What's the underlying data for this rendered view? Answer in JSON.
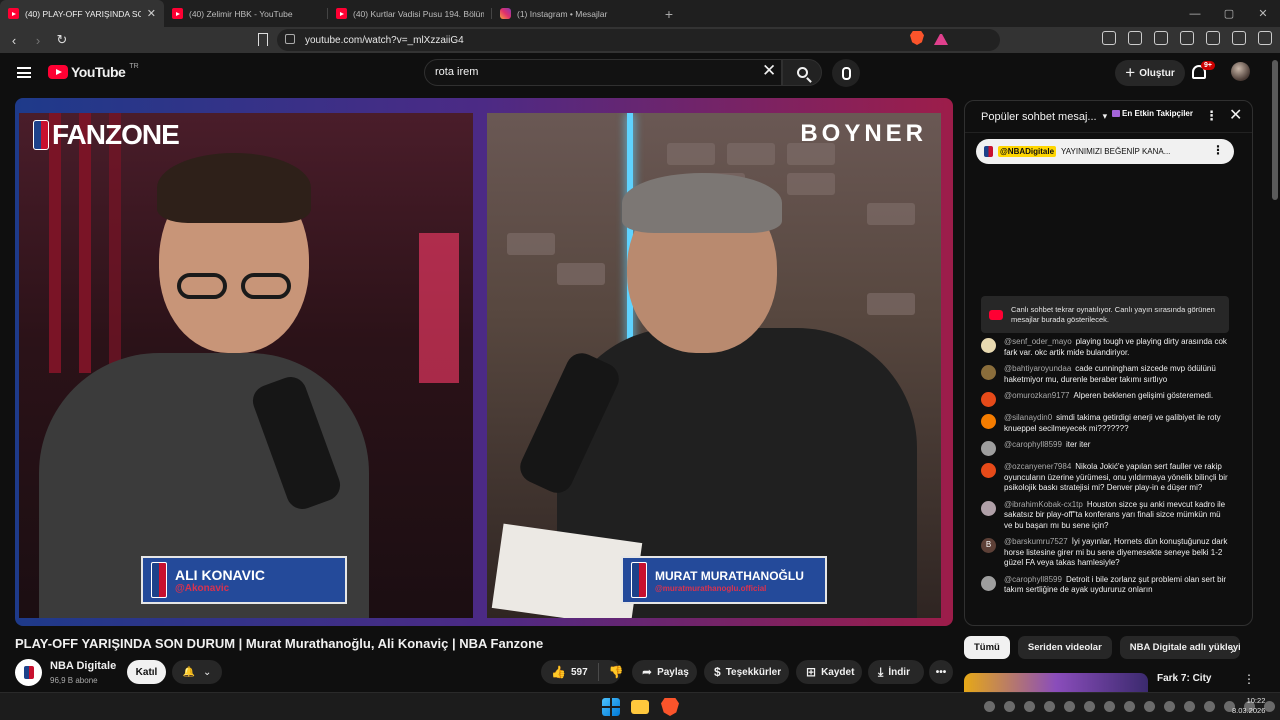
{
  "browser": {
    "tabs": [
      {
        "title": "(40) PLAY-OFF YARIŞINDA SO",
        "active": true,
        "icon": "youtube-icon"
      },
      {
        "title": "(40) Zelimir HBK - YouTube",
        "active": false,
        "icon": "youtube-icon"
      },
      {
        "title": "(40) Kurtlar Vadisi Pusu 194. Bölüm -",
        "active": false,
        "icon": "youtube-icon"
      },
      {
        "title": "(1) Instagram • Mesajlar",
        "active": false,
        "icon": "instagram-icon"
      }
    ],
    "new_tab": "+",
    "url": "youtube.com/watch?v=_mlXzzaiiG4",
    "window_controls": {
      "minimize": "—",
      "maximize": "▢",
      "close": "✕"
    }
  },
  "youtube": {
    "logo_text": "YouTube",
    "region": "TR",
    "search_value": "rota irem",
    "create_label": "Oluştur",
    "notification_count": "9+"
  },
  "video": {
    "title": "PLAY-OFF YARIŞINDA SON DURUM | Murat Murathanoğlu, Ali Konaviç | NBA Fanzone",
    "overlay_brand_left": "FANZONE",
    "overlay_brand_right": "BOYNER",
    "lower_third_left": {
      "name": "ALI KONAVIC",
      "handle": "@Akonavic"
    },
    "lower_third_right": {
      "name": "MURAT MURATHANOĞLU",
      "handle": "@muratmurathanoglu.official"
    }
  },
  "channel": {
    "name": "NBA Digitale",
    "subscribers": "96,9 B abone",
    "join_label": "Katıl"
  },
  "actions": {
    "likes": "597",
    "share": "Paylaş",
    "thanks": "Teşekkürler",
    "save": "Kaydet",
    "download": "İndir"
  },
  "chat": {
    "header": "Popüler sohbet mesaj...",
    "top_fans": "En Etkin Takipçiler",
    "pinned": {
      "author": "@NBADigitale",
      "text": "YAYINIMIZI BEĞENİP KANA..."
    },
    "replay_notice": "Canlı sohbet tekrar oynatılıyor. Canlı yayın sırasında görünen mesajlar burada gösterilecek.",
    "messages": [
      {
        "author": "@senf_oder_mayo",
        "text": "playing tough ve playing dirty arasında cok fark var. okc artik mide bulandiriyor.",
        "color": "#e8d9b0"
      },
      {
        "author": "@bahtiyaroyundaa",
        "text": "cade cunningham sizcede mvp ödülünü haketmiyor mu, durenle beraber takımı sırtlıyo",
        "color": "#8a6d3b"
      },
      {
        "author": "@omurozkan9177",
        "text": "Alperen beklenen gelişimi gösteremedi.",
        "color": "#e64a19"
      },
      {
        "author": "@silanaydin0",
        "text": "simdi takima getirdigi enerji ve galibiyet ile roty knueppel secilmeyecek mi???????",
        "color": "#f57c00"
      },
      {
        "author": "@carophyll8599",
        "text": "iter iter",
        "color": "#9e9e9e"
      },
      {
        "author": "@ozcanyener7984",
        "text": "Nikola Jokić'e yapılan sert fauller ve rakip oyuncuların üzerine yürümesi, onu yıldırmaya yönelik bilinçli bir psikolojik baskı stratejisi mi? Denver play-in e düşer mi?",
        "color": "#e64a19"
      },
      {
        "author": "@ibrahimKobak-cx1tp",
        "text": "Houston sizce şu anki mevcut kadro ile sakatsız bir play-off\"ta konferans yarı finali sizce mümkün mü ve bu başarı mı bu sene için?",
        "color": "#b0a0a8"
      },
      {
        "author": "@barskumru7527",
        "text": "İyi yayınlar, Hornets dün konuştuğunuz dark horse listesine girer mi bu sene diyemesekte seneye belki 1-2 güzel FA veya takas hamlesiyle?",
        "color": "#5d4037",
        "initial": "B"
      },
      {
        "author": "@carophyll8599",
        "text": "Detroit i bile zorlanz şut problemi olan sert bir takım sertliğine de ayak uydururuz onların",
        "color": "#9e9e9e"
      }
    ]
  },
  "chips": [
    "Tümü",
    "Seriden videolar",
    "NBA Digitale adlı yükleyici"
  ],
  "recommendation": {
    "title": "Fark 7: City"
  },
  "taskbar": {
    "time": "10:22",
    "date": "8.03.2026"
  }
}
